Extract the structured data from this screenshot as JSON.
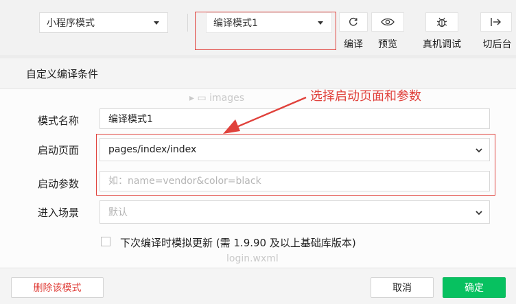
{
  "toolbar": {
    "mode_select": "小程序模式",
    "compile_select": "编译模式1",
    "buttons": {
      "compile": "编译",
      "preview": "预览",
      "remote_debug": "真机调试",
      "background": "切后台"
    }
  },
  "background": {
    "ghost_folder": "images",
    "ghost_file": "login.wxml"
  },
  "dialog": {
    "title": "自定义编译条件",
    "fields": {
      "mode_name": {
        "label": "模式名称",
        "value": "编译模式1"
      },
      "start_page": {
        "label": "启动页面",
        "value": "pages/index/index"
      },
      "start_params": {
        "label": "启动参数",
        "placeholder": "如：name=vendor&color=black"
      },
      "scene": {
        "label": "进入场景",
        "placeholder": "默认"
      }
    },
    "checkbox_label": "下次编译时模拟更新 (需 1.9.90 及以上基础库版本)",
    "footer": {
      "delete": "删除该模式",
      "cancel": "取消",
      "confirm": "确定"
    }
  },
  "annotation": {
    "text": "选择启动页面和参数",
    "color": "#e0413b"
  },
  "colors": {
    "accent_green": "#07c160",
    "danger_red": "#e0413b"
  }
}
